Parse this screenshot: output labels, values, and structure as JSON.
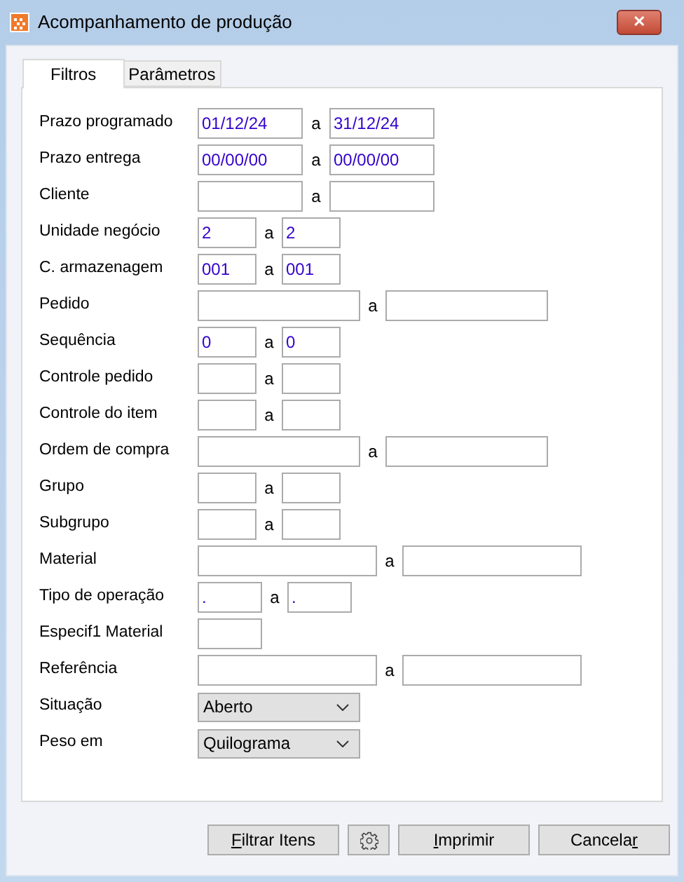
{
  "window": {
    "title": "Acompanhamento de produção",
    "close": "✕"
  },
  "tabs": [
    {
      "label": "Filtros",
      "selected": true
    },
    {
      "label": "Parâmetros",
      "selected": false
    }
  ],
  "fields": [
    {
      "kind": "date",
      "label": "Prazo programado",
      "from": "01/12/24",
      "sep": "a",
      "to": "31/12/24"
    },
    {
      "kind": "date",
      "label": "Prazo entrega",
      "from": "00/00/00",
      "sep": "a",
      "to": "00/00/00"
    },
    {
      "kind": "client",
      "label": "Cliente",
      "sep": "a"
    },
    {
      "kind": "code",
      "label": "Unidade negócio",
      "from": "2",
      "sep": "a",
      "to": "2"
    },
    {
      "kind": "code",
      "label": "C. armazenagem",
      "from": "001",
      "sep": "a",
      "to": "001"
    },
    {
      "kind": "text",
      "label": "Pedido",
      "sep": "a"
    },
    {
      "kind": "code",
      "label": "Sequência",
      "from": "0",
      "sep": "a",
      "to": "0"
    },
    {
      "kind": "code",
      "label": "Controle pedido",
      "sep": "a"
    },
    {
      "kind": "code",
      "label": "Controle do item",
      "sep": "a"
    },
    {
      "kind": "text",
      "label": "Ordem de compra",
      "sep": "a"
    },
    {
      "kind": "code",
      "label": "Grupo",
      "sep": "a"
    },
    {
      "kind": "code",
      "label": "Subgrupo",
      "sep": "a"
    },
    {
      "kind": "long",
      "label": "Material",
      "sep": "a"
    },
    {
      "kind": "operation",
      "label": "Tipo de operação",
      "from": ".",
      "sep": "a",
      "to": "."
    },
    {
      "kind": "single",
      "label": "Especif1 Material"
    },
    {
      "kind": "long",
      "label": "Referência",
      "sep": "a"
    },
    {
      "kind": "select",
      "label": "Situação",
      "value": "Aberto"
    },
    {
      "kind": "select",
      "label": "Peso em",
      "value": "Quilograma"
    }
  ],
  "buttons": [
    {
      "kind": "text",
      "key": "F",
      "after": "iltrar Itens"
    },
    {
      "kind": "gear"
    },
    {
      "kind": "text",
      "key": "I",
      "after": "mprimir"
    },
    {
      "kind": "text",
      "before": "Cancela",
      "key": "r"
    }
  ]
}
